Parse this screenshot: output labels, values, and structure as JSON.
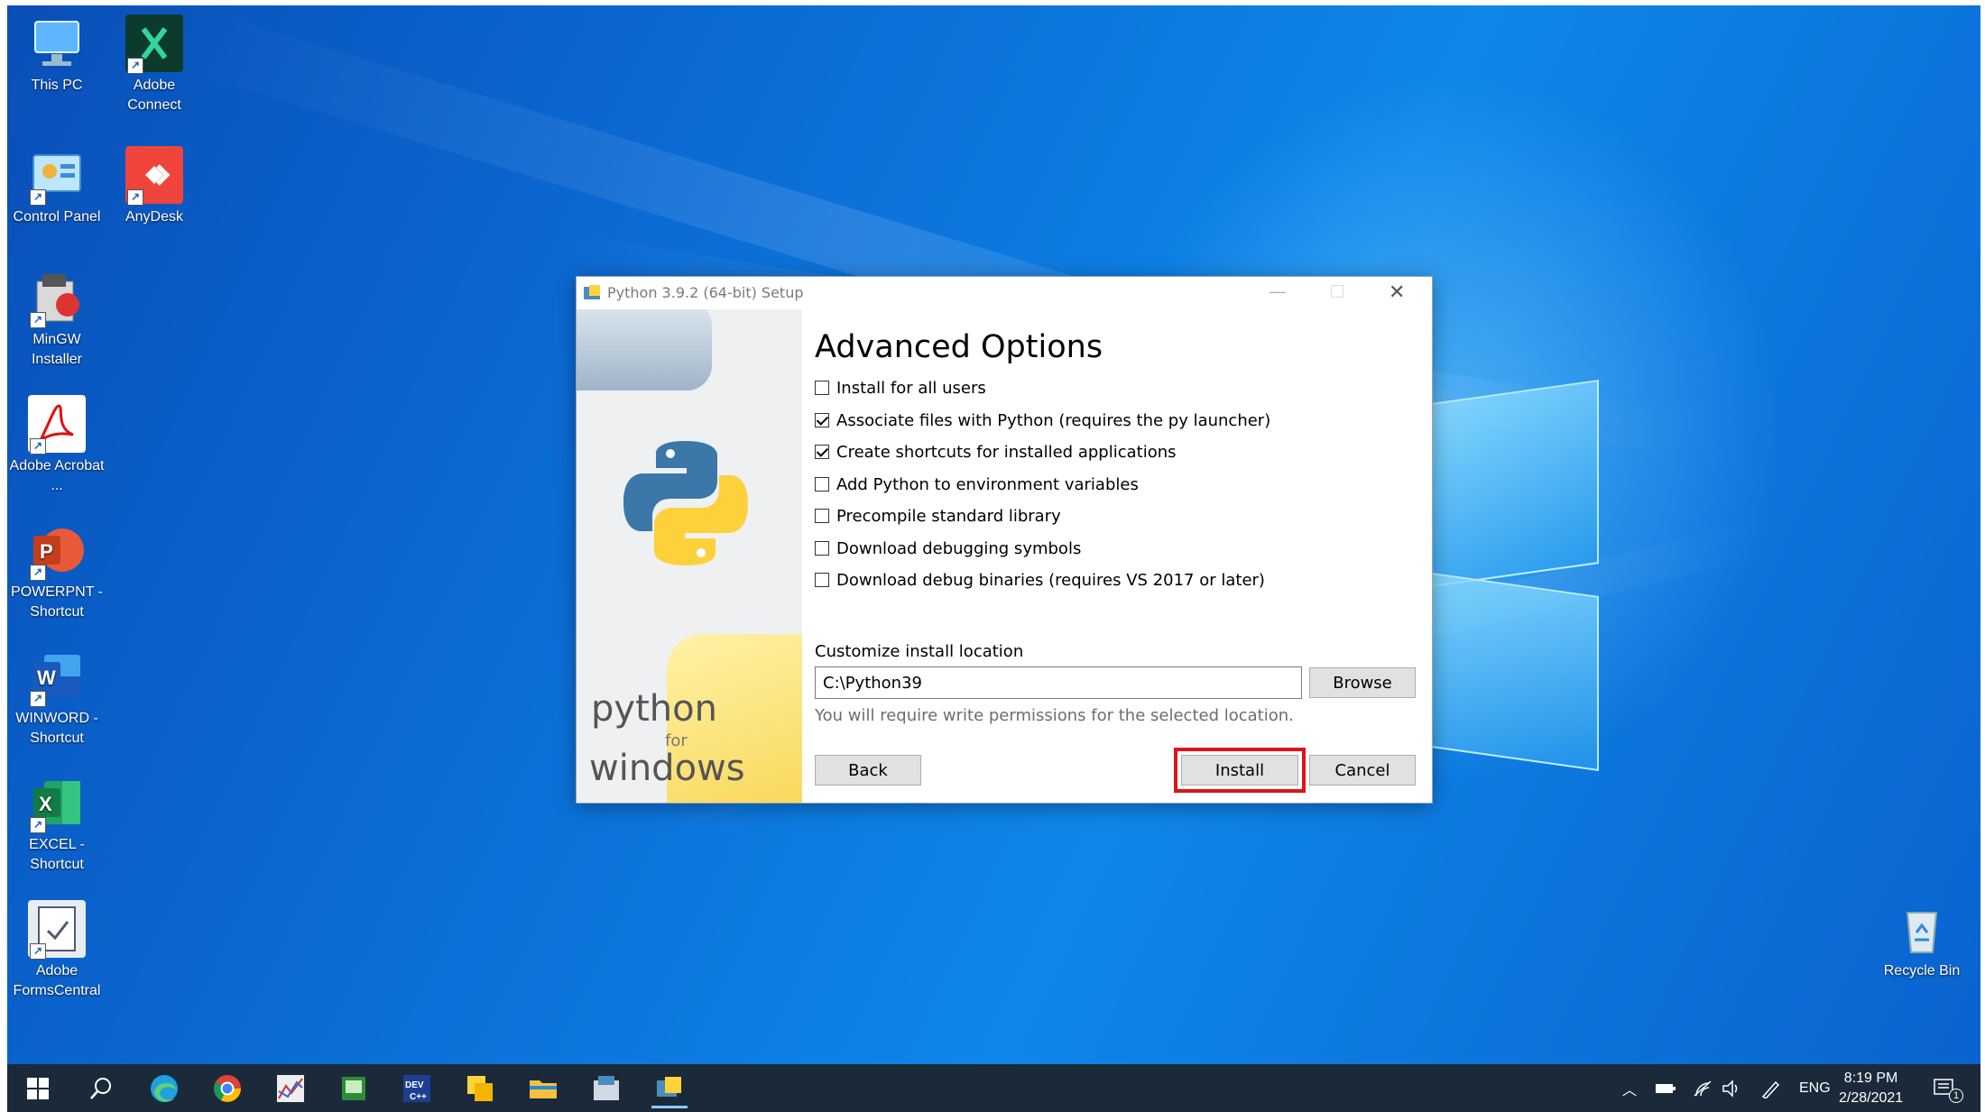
{
  "desktop": {
    "icons": [
      {
        "label": "This PC",
        "icon": "computer-icon"
      },
      {
        "label": "Adobe Connect",
        "icon": "adobe-connect-icon"
      },
      {
        "label": "Control Panel",
        "icon": "control-panel-icon"
      },
      {
        "label": "AnyDesk",
        "icon": "anydesk-icon"
      },
      {
        "label": "MinGW Installer",
        "icon": "mingw-icon"
      },
      {
        "label": "Adobe Acrobat ...",
        "icon": "acrobat-icon"
      },
      {
        "label": "POWERPNT - Shortcut",
        "icon": "powerpoint-icon"
      },
      {
        "label": "WINWORD - Shortcut",
        "icon": "word-icon"
      },
      {
        "label": "EXCEL - Shortcut",
        "icon": "excel-icon"
      },
      {
        "label": "Adobe FormsCentral",
        "icon": "formscentral-icon"
      },
      {
        "label": "Recycle Bin",
        "icon": "recycle-bin-icon"
      }
    ]
  },
  "dialog": {
    "title": "Python 3.9.2 (64-bit) Setup",
    "heading": "Advanced Options",
    "sidebar": {
      "word1": "python",
      "word2": "for",
      "word3": "windows"
    },
    "options": [
      {
        "label": "Install for all users",
        "checked": false
      },
      {
        "label": "Associate files with Python (requires the py launcher)",
        "checked": true
      },
      {
        "label": "Create shortcuts for installed applications",
        "checked": true
      },
      {
        "label": "Add Python to environment variables",
        "checked": false
      },
      {
        "label": "Precompile standard library",
        "checked": false
      },
      {
        "label": "Download debugging symbols",
        "checked": false
      },
      {
        "label": "Download debug binaries (requires VS 2017 or later)",
        "checked": false
      }
    ],
    "location_label": "Customize install location",
    "location_value": "C:\\Python39",
    "location_note": "You will require write permissions for the selected location.",
    "browse_label": "Browse",
    "back_label": "Back",
    "install_label": "Install",
    "cancel_label": "Cancel"
  },
  "taskbar": {
    "language": "ENG",
    "time": "8:19 PM",
    "date": "2/28/2021",
    "notification_count": "1"
  },
  "colors": {
    "highlight": "#e0121a",
    "desktop_blue": "#0b6fd8",
    "taskbar": "#1b2a3a"
  }
}
